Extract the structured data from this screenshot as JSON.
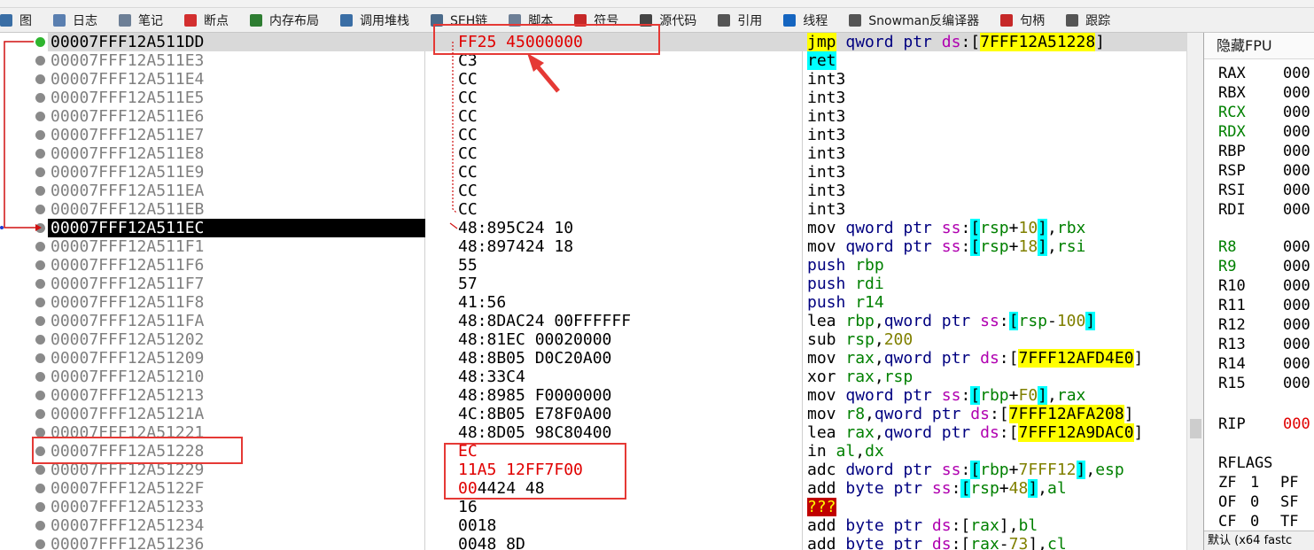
{
  "toolbar": {
    "tabs": [
      {
        "label": "图",
        "icon": "graph-icon",
        "color": "#3a6ea5"
      },
      {
        "label": "日志",
        "icon": "log-icon",
        "color": "#5a7fb0"
      },
      {
        "label": "笔记",
        "icon": "notes-icon",
        "color": "#6d7f96"
      },
      {
        "label": "断点",
        "icon": "breakpoint-icon",
        "color": "#d32f2f"
      },
      {
        "label": "内存布局",
        "icon": "memory-map-icon",
        "color": "#2e7d32"
      },
      {
        "label": "调用堆栈",
        "icon": "call-stack-icon",
        "color": "#3a6ea5"
      },
      {
        "label": "SEH链",
        "icon": "seh-chain-icon",
        "color": "#4a6a8a"
      },
      {
        "label": "脚本",
        "icon": "script-icon",
        "color": "#6d7f96"
      },
      {
        "label": "符号",
        "icon": "symbols-icon",
        "color": "#c62828"
      },
      {
        "label": "源代码",
        "icon": "source-code-icon",
        "color": "#444444"
      },
      {
        "label": "引用",
        "icon": "references-icon",
        "color": "#555555"
      },
      {
        "label": "线程",
        "icon": "threads-icon",
        "color": "#1565c0"
      },
      {
        "label": "Snowman反编译器",
        "icon": "snowman-icon",
        "color": "#555555"
      },
      {
        "label": "句柄",
        "icon": "handles-icon",
        "color": "#c62828"
      },
      {
        "label": "跟踪",
        "icon": "trace-icon",
        "color": "#555555"
      }
    ]
  },
  "disassembly": {
    "rows": [
      {
        "address": "00007FFF12A511DD",
        "bytes": "FF25 45000000",
        "state": "current",
        "dot": "green",
        "bytes_red": true,
        "fold": "v",
        "instr": [
          {
            "t": "jmp",
            "c": "m-jmp"
          },
          {
            "t": " "
          },
          {
            "t": "qword ptr",
            "c": "t-navy"
          },
          {
            "t": " "
          },
          {
            "t": "ds",
            "c": "t-magenta"
          },
          {
            "t": ":["
          },
          {
            "t": "7FFF12A51228",
            "c": "b-yellow"
          },
          {
            "t": "]"
          }
        ]
      },
      {
        "address": "00007FFF12A511E3",
        "bytes": "C3",
        "instr": [
          {
            "t": "ret",
            "c": "m-ret"
          }
        ]
      },
      {
        "address": "00007FFF12A511E4",
        "bytes": "CC",
        "instr": [
          {
            "t": "int3"
          }
        ]
      },
      {
        "address": "00007FFF12A511E5",
        "bytes": "CC",
        "instr": [
          {
            "t": "int3"
          }
        ]
      },
      {
        "address": "00007FFF12A511E6",
        "bytes": "CC",
        "instr": [
          {
            "t": "int3"
          }
        ]
      },
      {
        "address": "00007FFF12A511E7",
        "bytes": "CC",
        "instr": [
          {
            "t": "int3"
          }
        ]
      },
      {
        "address": "00007FFF12A511E8",
        "bytes": "CC",
        "instr": [
          {
            "t": "int3"
          }
        ]
      },
      {
        "address": "00007FFF12A511E9",
        "bytes": "CC",
        "instr": [
          {
            "t": "int3"
          }
        ]
      },
      {
        "address": "00007FFF12A511EA",
        "bytes": "CC",
        "instr": [
          {
            "t": "int3"
          }
        ]
      },
      {
        "address": "00007FFF12A511EB",
        "bytes": "CC",
        "instr": [
          {
            "t": "int3"
          }
        ]
      },
      {
        "address": "00007FFF12A511EC",
        "bytes": "48:895C24 10",
        "state": "selected",
        "instr": [
          {
            "t": "mov"
          },
          {
            "t": " "
          },
          {
            "t": "qword ptr",
            "c": "t-navy"
          },
          {
            "t": " "
          },
          {
            "t": "ss",
            "c": "t-magenta"
          },
          {
            "t": ":"
          },
          {
            "t": "[",
            "c": "b-cyan"
          },
          {
            "t": "rsp",
            "c": "t-green"
          },
          {
            "t": "+"
          },
          {
            "t": "10",
            "c": "t-olive"
          },
          {
            "t": "]",
            "c": "b-cyan"
          },
          {
            "t": ","
          },
          {
            "t": "rbx",
            "c": "t-green"
          }
        ]
      },
      {
        "address": "00007FFF12A511F1",
        "bytes": "48:897424 18",
        "instr": [
          {
            "t": "mov"
          },
          {
            "t": " "
          },
          {
            "t": "qword ptr",
            "c": "t-navy"
          },
          {
            "t": " "
          },
          {
            "t": "ss",
            "c": "t-magenta"
          },
          {
            "t": ":"
          },
          {
            "t": "[",
            "c": "b-cyan"
          },
          {
            "t": "rsp",
            "c": "t-green"
          },
          {
            "t": "+"
          },
          {
            "t": "18",
            "c": "t-olive"
          },
          {
            "t": "]",
            "c": "b-cyan"
          },
          {
            "t": ","
          },
          {
            "t": "rsi",
            "c": "t-green"
          }
        ]
      },
      {
        "address": "00007FFF12A511F6",
        "bytes": "55",
        "instr": [
          {
            "t": "push",
            "c": "t-navy"
          },
          {
            "t": " "
          },
          {
            "t": "rbp",
            "c": "t-green"
          }
        ]
      },
      {
        "address": "00007FFF12A511F7",
        "bytes": "57",
        "instr": [
          {
            "t": "push",
            "c": "t-navy"
          },
          {
            "t": " "
          },
          {
            "t": "rdi",
            "c": "t-green"
          }
        ]
      },
      {
        "address": "00007FFF12A511F8",
        "bytes": "41:56",
        "instr": [
          {
            "t": "push",
            "c": "t-navy"
          },
          {
            "t": " "
          },
          {
            "t": "r14",
            "c": "t-green"
          }
        ]
      },
      {
        "address": "00007FFF12A511FA",
        "bytes": "48:8DAC24 00FFFFFF",
        "instr": [
          {
            "t": "lea"
          },
          {
            "t": " "
          },
          {
            "t": "rbp",
            "c": "t-green"
          },
          {
            "t": ","
          },
          {
            "t": "qword ptr",
            "c": "t-navy"
          },
          {
            "t": " "
          },
          {
            "t": "ss",
            "c": "t-magenta"
          },
          {
            "t": ":"
          },
          {
            "t": "[",
            "c": "b-cyan"
          },
          {
            "t": "rsp",
            "c": "t-green"
          },
          {
            "t": "-"
          },
          {
            "t": "100",
            "c": "t-olive"
          },
          {
            "t": "]",
            "c": "b-cyan"
          }
        ]
      },
      {
        "address": "00007FFF12A51202",
        "bytes": "48:81EC 00020000",
        "instr": [
          {
            "t": "sub"
          },
          {
            "t": " "
          },
          {
            "t": "rsp",
            "c": "t-green"
          },
          {
            "t": ","
          },
          {
            "t": "200",
            "c": "t-olive"
          }
        ]
      },
      {
        "address": "00007FFF12A51209",
        "bytes": "48:8B05 D0C20A00",
        "instr": [
          {
            "t": "mov"
          },
          {
            "t": " "
          },
          {
            "t": "rax",
            "c": "t-green"
          },
          {
            "t": ","
          },
          {
            "t": "qword ptr",
            "c": "t-navy"
          },
          {
            "t": " "
          },
          {
            "t": "ds",
            "c": "t-magenta"
          },
          {
            "t": ":["
          },
          {
            "t": "7FFF12AFD4E0",
            "c": "b-yellow"
          },
          {
            "t": "]"
          }
        ]
      },
      {
        "address": "00007FFF12A51210",
        "bytes": "48:33C4",
        "instr": [
          {
            "t": "xor"
          },
          {
            "t": " "
          },
          {
            "t": "rax",
            "c": "t-green"
          },
          {
            "t": ","
          },
          {
            "t": "rsp",
            "c": "t-green"
          }
        ]
      },
      {
        "address": "00007FFF12A51213",
        "bytes": "48:8985 F0000000",
        "instr": [
          {
            "t": "mov"
          },
          {
            "t": " "
          },
          {
            "t": "qword ptr",
            "c": "t-navy"
          },
          {
            "t": " "
          },
          {
            "t": "ss",
            "c": "t-magenta"
          },
          {
            "t": ":"
          },
          {
            "t": "[",
            "c": "b-cyan"
          },
          {
            "t": "rbp",
            "c": "t-green"
          },
          {
            "t": "+"
          },
          {
            "t": "F0",
            "c": "t-olive"
          },
          {
            "t": "]",
            "c": "b-cyan"
          },
          {
            "t": ","
          },
          {
            "t": "rax",
            "c": "t-green"
          }
        ]
      },
      {
        "address": "00007FFF12A5121A",
        "bytes": "4C:8B05 E78F0A00",
        "instr": [
          {
            "t": "mov"
          },
          {
            "t": " "
          },
          {
            "t": "r8",
            "c": "t-green"
          },
          {
            "t": ","
          },
          {
            "t": "qword ptr",
            "c": "t-navy"
          },
          {
            "t": " "
          },
          {
            "t": "ds",
            "c": "t-magenta"
          },
          {
            "t": ":["
          },
          {
            "t": "7FFF12AFA208",
            "c": "b-yellow"
          },
          {
            "t": "]"
          }
        ]
      },
      {
        "address": "00007FFF12A51221",
        "bytes": "48:8D05 98C80400",
        "instr": [
          {
            "t": "lea"
          },
          {
            "t": " "
          },
          {
            "t": "rax",
            "c": "t-green"
          },
          {
            "t": ","
          },
          {
            "t": "qword ptr",
            "c": "t-navy"
          },
          {
            "t": " "
          },
          {
            "t": "ds",
            "c": "t-magenta"
          },
          {
            "t": ":["
          },
          {
            "t": "7FFF12A9DAC0",
            "c": "b-yellow"
          },
          {
            "t": "]"
          }
        ]
      },
      {
        "address": "00007FFF12A51228",
        "bytes": "EC",
        "bytes_red": true,
        "instr": [
          {
            "t": "in"
          },
          {
            "t": " "
          },
          {
            "t": "al",
            "c": "t-green"
          },
          {
            "t": ","
          },
          {
            "t": "dx",
            "c": "t-green"
          }
        ]
      },
      {
        "address": "00007FFF12A51229",
        "bytes": "11A5 12FF7F00",
        "bytes_red": true,
        "instr": [
          {
            "t": "adc"
          },
          {
            "t": " "
          },
          {
            "t": "dword ptr",
            "c": "t-navy"
          },
          {
            "t": " "
          },
          {
            "t": "ss",
            "c": "t-magenta"
          },
          {
            "t": ":"
          },
          {
            "t": "[",
            "c": "b-cyan"
          },
          {
            "t": "rbp",
            "c": "t-green"
          },
          {
            "t": "+"
          },
          {
            "t": "7FFF12",
            "c": "t-olive"
          },
          {
            "t": "]",
            "c": "b-cyan"
          },
          {
            "t": ","
          },
          {
            "t": "esp",
            "c": "t-green"
          }
        ]
      },
      {
        "address": "00007FFF12A5122F",
        "bytes": "004424 48",
        "bytes_red_prefix": "00",
        "bytes_rest": "4424 48",
        "instr": [
          {
            "t": "add"
          },
          {
            "t": " "
          },
          {
            "t": "byte ptr",
            "c": "t-navy"
          },
          {
            "t": " "
          },
          {
            "t": "ss",
            "c": "t-magenta"
          },
          {
            "t": ":"
          },
          {
            "t": "[",
            "c": "b-cyan"
          },
          {
            "t": "rsp",
            "c": "t-green"
          },
          {
            "t": "+"
          },
          {
            "t": "48",
            "c": "t-olive"
          },
          {
            "t": "]",
            "c": "b-cyan"
          },
          {
            "t": ","
          },
          {
            "t": "al",
            "c": "t-green"
          }
        ]
      },
      {
        "address": "00007FFF12A51233",
        "bytes": "16",
        "instr": [
          {
            "t": "???",
            "c": "m-bad"
          }
        ]
      },
      {
        "address": "00007FFF12A51234",
        "bytes": "0018",
        "instr": [
          {
            "t": "add"
          },
          {
            "t": " "
          },
          {
            "t": "byte ptr",
            "c": "t-navy"
          },
          {
            "t": " "
          },
          {
            "t": "ds",
            "c": "t-magenta"
          },
          {
            "t": ":["
          },
          {
            "t": "rax",
            "c": "t-green"
          },
          {
            "t": "],"
          },
          {
            "t": "bl",
            "c": "t-green"
          }
        ]
      },
      {
        "address": "00007FFF12A51236",
        "bytes": "0048 8D",
        "instr": [
          {
            "t": "add"
          },
          {
            "t": " "
          },
          {
            "t": "byte ptr",
            "c": "t-navy"
          },
          {
            "t": " "
          },
          {
            "t": "ds",
            "c": "t-magenta"
          },
          {
            "t": ":["
          },
          {
            "t": "rax",
            "c": "t-green"
          },
          {
            "t": "-"
          },
          {
            "t": "73",
            "c": "t-olive"
          },
          {
            "t": "],"
          },
          {
            "t": "cl",
            "c": "t-green"
          }
        ]
      }
    ]
  },
  "registers": {
    "title": "隐藏FPU",
    "general": [
      {
        "name": "RAX",
        "value": "000"
      },
      {
        "name": "RBX",
        "value": "000"
      },
      {
        "name": "RCX",
        "value": "000",
        "green": true
      },
      {
        "name": "RDX",
        "value": "000",
        "green": true
      },
      {
        "name": "RBP",
        "value": "000"
      },
      {
        "name": "RSP",
        "value": "000"
      },
      {
        "name": "RSI",
        "value": "000"
      },
      {
        "name": "RDI",
        "value": "000"
      }
    ],
    "extended": [
      {
        "name": "R8",
        "value": "000",
        "green": true
      },
      {
        "name": "R9",
        "value": "000",
        "green": true
      },
      {
        "name": "R10",
        "value": "000"
      },
      {
        "name": "R11",
        "value": "000"
      },
      {
        "name": "R12",
        "value": "000"
      },
      {
        "name": "R13",
        "value": "000"
      },
      {
        "name": "R14",
        "value": "000"
      },
      {
        "name": "R15",
        "value": "000"
      }
    ],
    "rip": {
      "name": "RIP",
      "value": "000"
    },
    "rflags_label": "RFLAGS",
    "flags": [
      [
        {
          "name": "ZF",
          "value": "1"
        },
        {
          "name": "PF",
          "value": ""
        }
      ],
      [
        {
          "name": "OF",
          "value": "0"
        },
        {
          "name": "SF",
          "value": ""
        }
      ],
      [
        {
          "name": "CF",
          "value": "0"
        },
        {
          "name": "TF",
          "value": ""
        }
      ]
    ],
    "status": "默认 (x64 fastc"
  }
}
